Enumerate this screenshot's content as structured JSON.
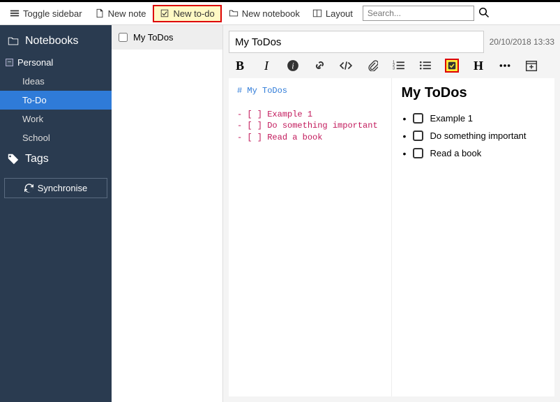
{
  "toolbar": {
    "toggle_sidebar": "Toggle sidebar",
    "new_note": "New note",
    "new_todo": "New to-do",
    "new_notebook": "New notebook",
    "layout": "Layout",
    "search_placeholder": "Search..."
  },
  "sidebar": {
    "notebooks_label": "Notebooks",
    "tags_label": "Tags",
    "sync_label": "Synchronise",
    "notebooks": [
      {
        "name": "Personal",
        "children": [
          {
            "name": "Ideas",
            "active": false
          },
          {
            "name": "To-Do",
            "active": true
          },
          {
            "name": "Work",
            "active": false
          },
          {
            "name": "School",
            "active": false
          }
        ]
      }
    ]
  },
  "notelist": {
    "items": [
      {
        "title": "My ToDos",
        "checked": false
      }
    ]
  },
  "note": {
    "title": "My ToDos",
    "timestamp": "20/10/2018 13:33",
    "markdown": {
      "heading": "# My ToDos",
      "lines": [
        {
          "prefix": "- [ ] ",
          "text": "Example 1"
        },
        {
          "prefix": "- [ ] ",
          "text": "Do something important"
        },
        {
          "prefix": "- [ ] ",
          "text": "Read a book"
        }
      ]
    },
    "preview": {
      "heading": "My ToDos",
      "items": [
        "Example 1",
        "Do something important",
        "Read a book"
      ]
    }
  }
}
